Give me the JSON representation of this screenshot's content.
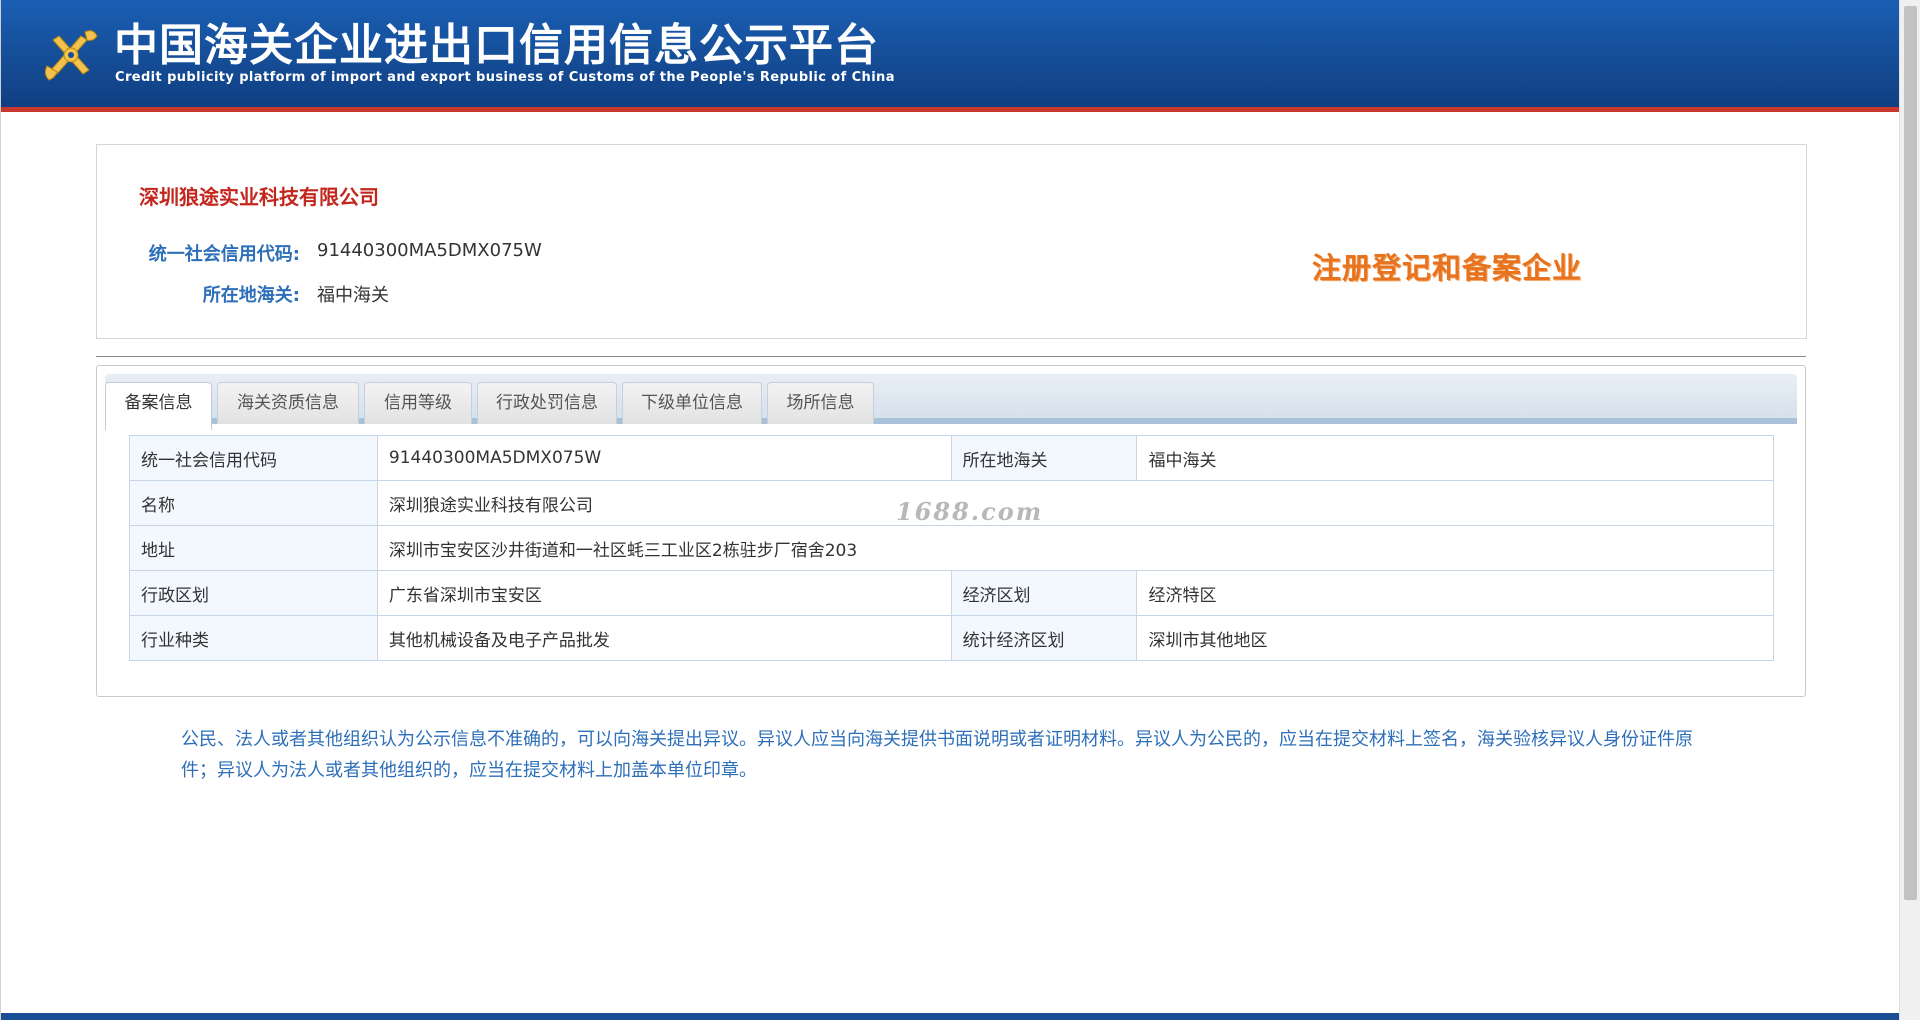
{
  "header": {
    "title_cn": "中国海关企业进出口信用信息公示平台",
    "title_en": "Credit publicity platform of import and export business of Customs of the People's Republic of China",
    "logo_icon": "customs-emblem-icon"
  },
  "company": {
    "name": "深圳狼途实业科技有限公司",
    "credit_code_label": "统一社会信用代码:",
    "credit_code": "91440300MA5DMX075W",
    "customs_label": "所在地海关:",
    "customs": "福中海关",
    "status_badge": "注册登记和备案企业"
  },
  "tabs": [
    {
      "label": "备案信息",
      "active": true
    },
    {
      "label": "海关资质信息",
      "active": false
    },
    {
      "label": "信用等级",
      "active": false
    },
    {
      "label": "行政处罚信息",
      "active": false
    },
    {
      "label": "下级单位信息",
      "active": false
    },
    {
      "label": "场所信息",
      "active": false
    }
  ],
  "record": {
    "credit_code_label": "统一社会信用代码",
    "credit_code": "91440300MA5DMX075W",
    "customs_label": "所在地海关",
    "customs": "福中海关",
    "name_label": "名称",
    "name": "深圳狼途实业科技有限公司",
    "address_label": "地址",
    "address": "深圳市宝安区沙井街道和一社区蚝三工业区2栋驻步厂宿舍203",
    "admin_division_label": "行政区划",
    "admin_division": "广东省深圳市宝安区",
    "economic_zone_label": "经济区划",
    "economic_zone": "经济特区",
    "industry_label": "行业种类",
    "industry": "其他机械设备及电子产品批发",
    "stat_zone_label": "统计经济区划",
    "stat_zone": "深圳市其他地区"
  },
  "watermark": "1688.com",
  "notice": "公民、法人或者其他组织认为公示信息不准确的，可以向海关提出异议。异议人应当向海关提供书面说明或者证明材料。异议人为公民的，应当在提交材料上签名，海关验核异议人身份证件原件；异议人为法人或者其他组织的，应当在提交材料上加盖本单位印章。",
  "colors": {
    "header_blue": "#1a5fb4",
    "header_red_line": "#c8372e",
    "company_name_red": "#c2261d",
    "label_blue": "#2e6fb9",
    "badge_orange": "#e8731e"
  }
}
